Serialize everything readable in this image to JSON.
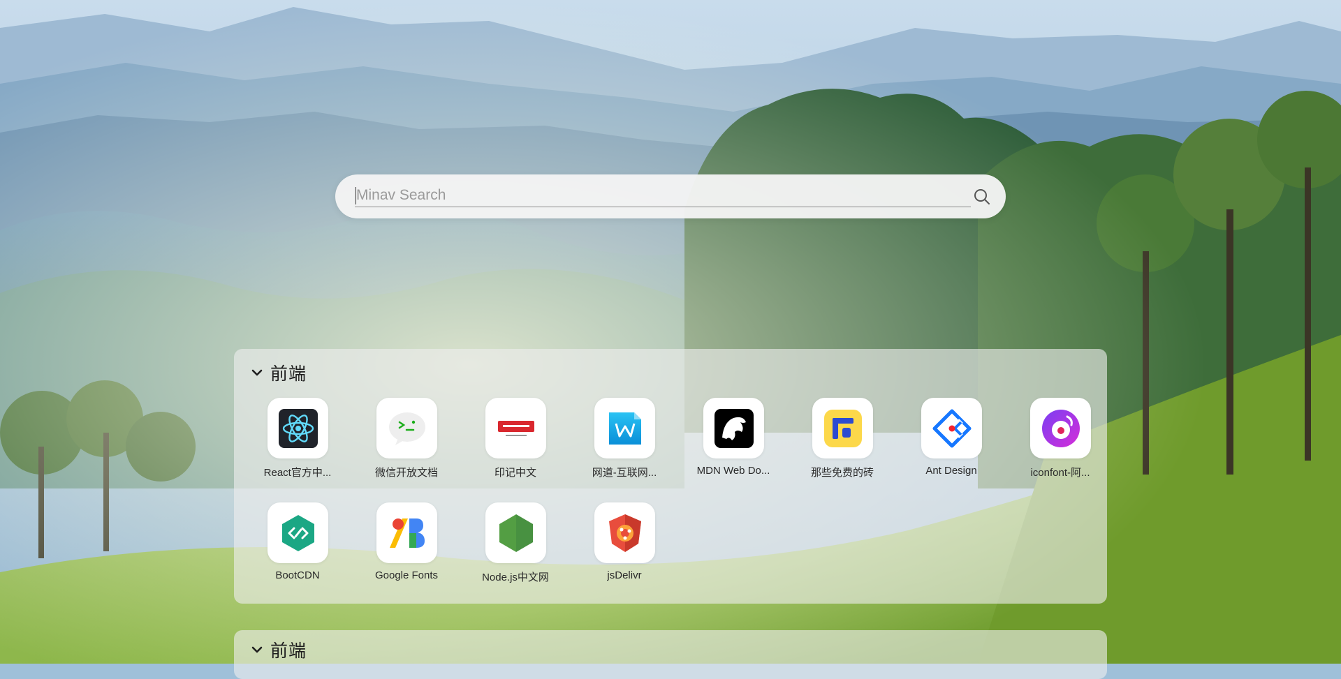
{
  "search": {
    "placeholder": "Minav Search",
    "value": ""
  },
  "sections": [
    {
      "title": "前端",
      "sites": [
        {
          "label": "React官方中...",
          "icon": "react-logo-icon"
        },
        {
          "label": "微信开放文档",
          "icon": "wechat-dev-icon"
        },
        {
          "label": "印记中文",
          "icon": "docschina-icon"
        },
        {
          "label": "网道-互联网...",
          "icon": "wangdoc-icon"
        },
        {
          "label": "MDN Web Do...",
          "icon": "mdn-dino-icon"
        },
        {
          "label": "那些免费的砖",
          "icon": "free-bricks-icon"
        },
        {
          "label": "Ant Design",
          "icon": "ant-design-icon"
        },
        {
          "label": "iconfont-阿...",
          "icon": "iconfont-icon"
        },
        {
          "label": "BootCDN",
          "icon": "bootcdn-icon"
        },
        {
          "label": "Google Fonts",
          "icon": "google-fonts-icon"
        },
        {
          "label": "Node.js中文网",
          "icon": "nodejs-icon"
        },
        {
          "label": "jsDelivr",
          "icon": "jsdelivr-icon"
        }
      ]
    },
    {
      "title": "前端"
    }
  ],
  "colors": {
    "panel": "#eeeeee",
    "search_bg": "#f4f4f4",
    "react": "#61dafb",
    "ant": "#1677ff",
    "iconfont": "#7b3ff2",
    "bootcdn": "#1ba784",
    "node": "#539e43",
    "jsdelivr": "#e84d3d"
  }
}
